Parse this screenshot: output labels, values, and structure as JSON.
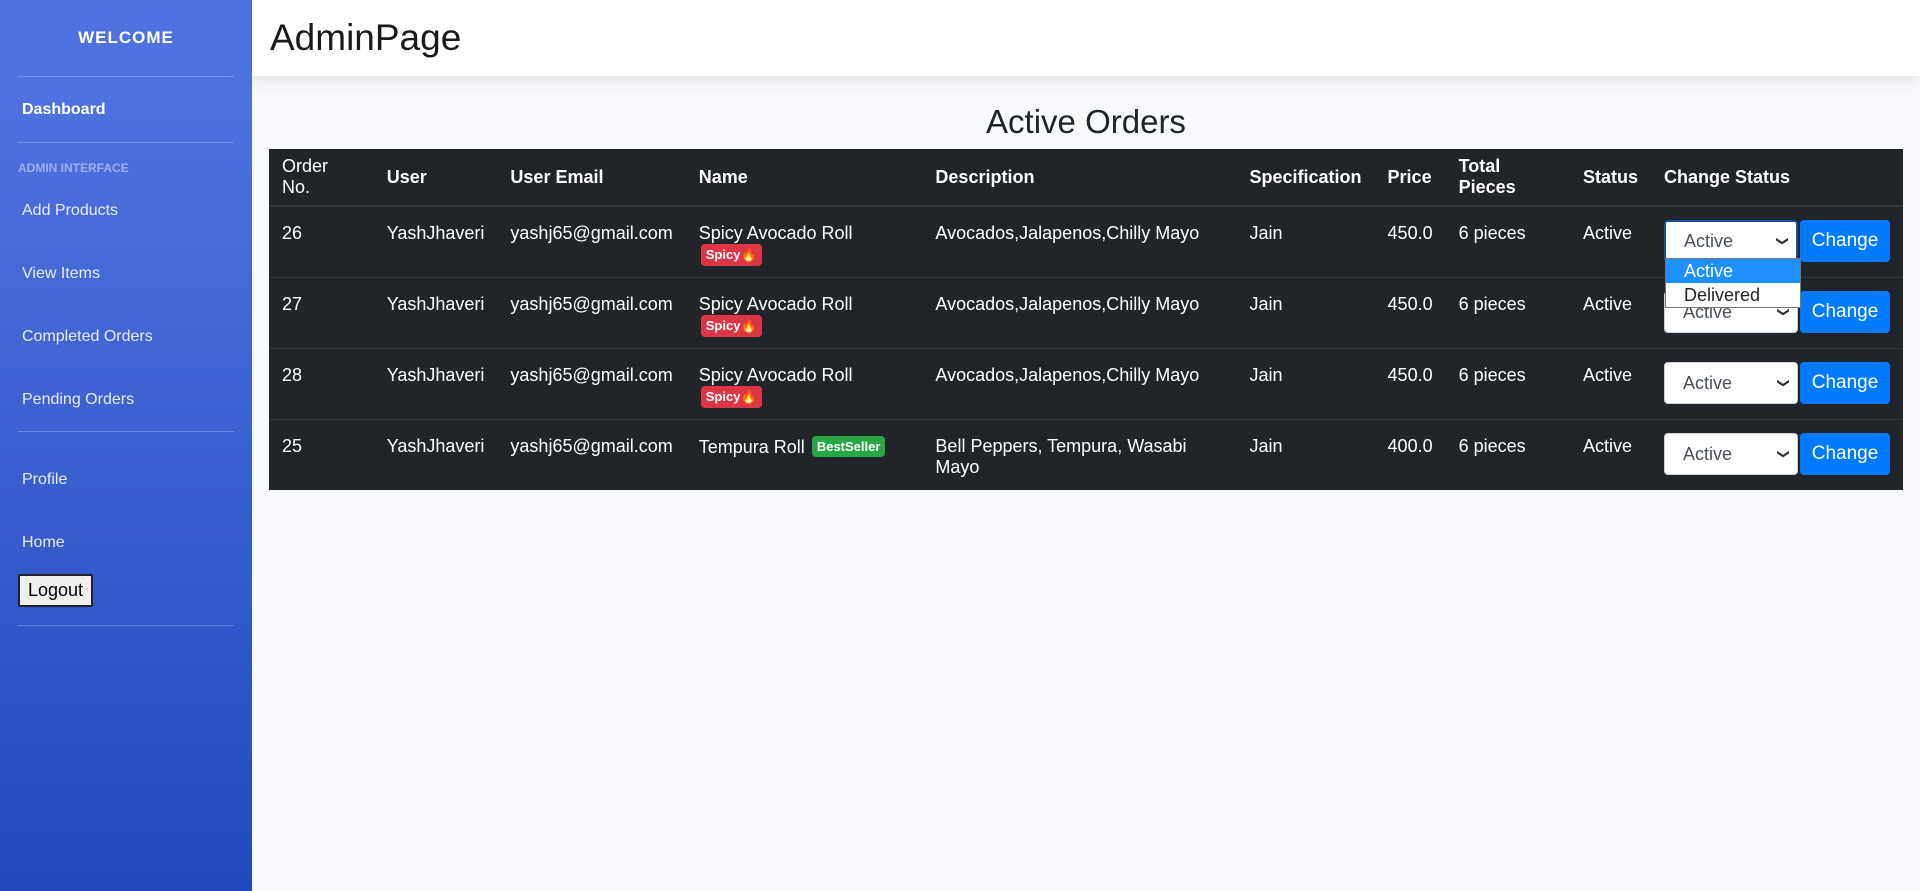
{
  "sidebar": {
    "brand": "WELCOME",
    "dashboard": "Dashboard",
    "heading": "Admin Interface",
    "items": [
      {
        "label": "Add Products"
      },
      {
        "label": "View Items"
      },
      {
        "label": "Completed Orders"
      },
      {
        "label": "Pending Orders"
      }
    ],
    "profile": "Profile",
    "home": "Home",
    "logout": "Logout"
  },
  "header": {
    "title": "AdminPage"
  },
  "main": {
    "section_title": "Active Orders",
    "columns": [
      "Order No.",
      "User",
      "User Email",
      "Name",
      "Description",
      "Specification",
      "Price",
      "Total Pieces",
      "Status",
      "Change Status"
    ],
    "rows": [
      {
        "order_no": "26",
        "user": "YashJhaveri",
        "email": "yashj65@gmail.com",
        "name": "Spicy Avocado Roll",
        "badge": "Spicy🔥",
        "description": "Avocados,Jalapenos,Chilly Mayo",
        "specification": "Jain",
        "price": "450.0",
        "pieces": "6 pieces",
        "status": "Active",
        "selected": "Active",
        "button": "Change"
      },
      {
        "order_no": "27",
        "user": "YashJhaveri",
        "email": "yashj65@gmail.com",
        "name": "Spicy Avocado Roll",
        "badge": "Spicy🔥",
        "description": "Avocados,Jalapenos,Chilly Mayo",
        "specification": "Jain",
        "price": "450.0",
        "pieces": "6 pieces",
        "status": "Active",
        "selected": "Active",
        "button": "Change"
      },
      {
        "order_no": "28",
        "user": "YashJhaveri",
        "email": "yashj65@gmail.com",
        "name": "Spicy Avocado Roll",
        "badge": "Spicy🔥",
        "description": "Avocados,Jalapenos,Chilly Mayo",
        "specification": "Jain",
        "price": "450.0",
        "pieces": "6 pieces",
        "status": "Active",
        "selected": "Active",
        "button": "Change"
      },
      {
        "order_no": "25",
        "user": "YashJhaveri",
        "email": "yashj65@gmail.com",
        "name": "Tempura Roll",
        "badge": "BestSeller",
        "description": "Bell Peppers, Tempura, Wasabi Mayo",
        "specification": "Jain",
        "price": "400.0",
        "pieces": "6 pieces",
        "status": "Active",
        "selected": "Active",
        "button": "Change"
      }
    ],
    "dropdown_options": [
      "Active",
      "Delivered"
    ]
  },
  "colors": {
    "sidebar_top": "#4e73df",
    "sidebar_bottom": "#224abe",
    "table_bg": "#212529",
    "button": "#007bff",
    "badge_spicy": "#dc3545",
    "badge_best": "#28a745"
  }
}
